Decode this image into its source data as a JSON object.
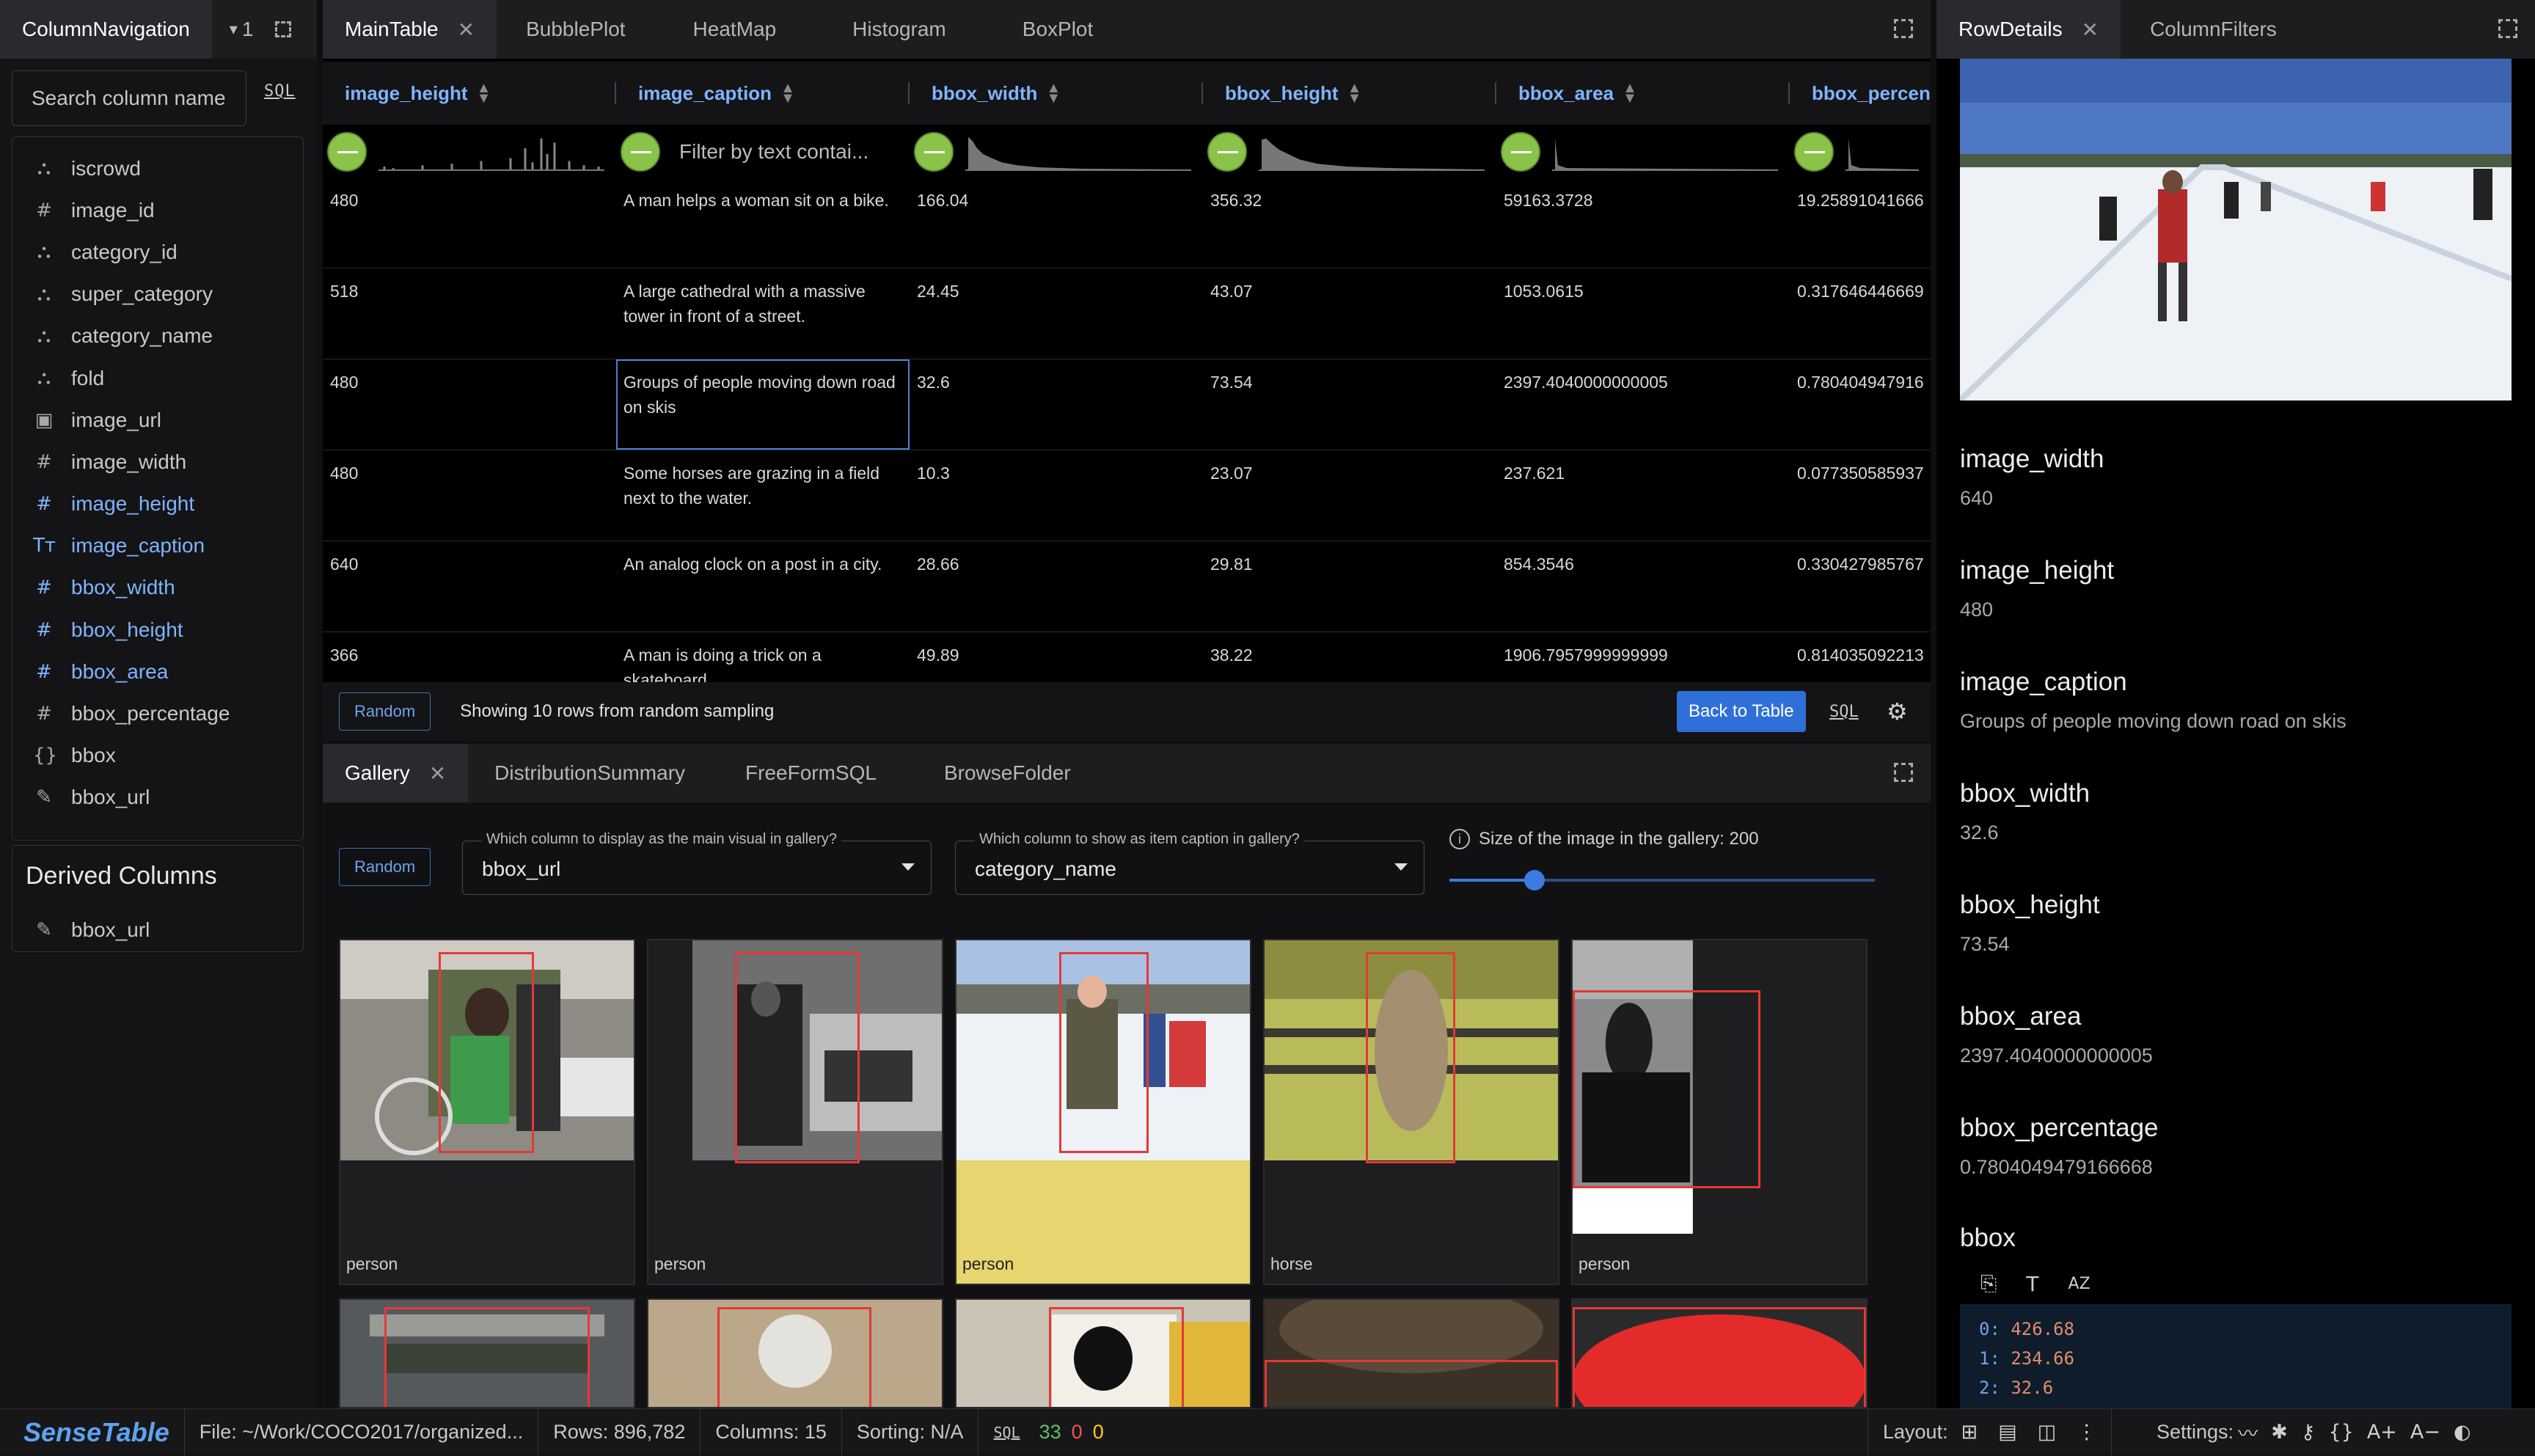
{
  "left_panel": {
    "tab_title": "ColumnNavigation",
    "tab_count": "1",
    "search_placeholder": "Search column name",
    "sql_label": "SQL",
    "columns": [
      {
        "icon": "category-icon",
        "glyph": "⛬",
        "label": "iscrowd",
        "highlighted": false
      },
      {
        "icon": "hash-icon",
        "glyph": "#",
        "label": "image_id",
        "highlighted": false
      },
      {
        "icon": "category-icon",
        "glyph": "⛬",
        "label": "category_id",
        "highlighted": false
      },
      {
        "icon": "category-icon",
        "glyph": "⛬",
        "label": "super_category",
        "highlighted": false
      },
      {
        "icon": "category-icon",
        "glyph": "⛬",
        "label": "category_name",
        "highlighted": false
      },
      {
        "icon": "category-icon",
        "glyph": "⛬",
        "label": "fold",
        "highlighted": false
      },
      {
        "icon": "image-icon",
        "glyph": "▣",
        "label": "image_url",
        "highlighted": false
      },
      {
        "icon": "hash-icon",
        "glyph": "#",
        "label": "image_width",
        "highlighted": false
      },
      {
        "icon": "hash-icon",
        "glyph": "#",
        "label": "image_height",
        "highlighted": true
      },
      {
        "icon": "text-icon",
        "glyph": "Tт",
        "label": "image_caption",
        "highlighted": true
      },
      {
        "icon": "hash-icon",
        "glyph": "#",
        "label": "bbox_width",
        "highlighted": true
      },
      {
        "icon": "hash-icon",
        "glyph": "#",
        "label": "bbox_height",
        "highlighted": true
      },
      {
        "icon": "hash-icon",
        "glyph": "#",
        "label": "bbox_area",
        "highlighted": true
      },
      {
        "icon": "hash-icon",
        "glyph": "#",
        "label": "bbox_percentage",
        "highlighted": false
      },
      {
        "icon": "braces-icon",
        "glyph": "{}",
        "label": "bbox",
        "highlighted": false
      },
      {
        "icon": "brush-icon",
        "glyph": "✎",
        "label": "bbox_url",
        "highlighted": false
      }
    ],
    "derived_title": "Derived Columns",
    "derived_columns": [
      {
        "icon": "brush-icon",
        "glyph": "✎",
        "label": "bbox_url"
      }
    ]
  },
  "main_panel": {
    "tabs": [
      "MainTable",
      "BubblePlot",
      "HeatMap",
      "Histogram",
      "BoxPlot"
    ],
    "columns": [
      "image_height",
      "image_caption",
      "bbox_width",
      "bbox_height",
      "bbox_area",
      "bbox_percen"
    ],
    "caption_filter_placeholder": "Filter by text contai...",
    "rows": [
      {
        "image_height": "480",
        "image_caption": "A man helps a woman sit on a bike.",
        "bbox_width": "166.04",
        "bbox_height": "356.32",
        "bbox_area": "59163.3728",
        "bbox_percentage": "19.25891041666"
      },
      {
        "image_height": "518",
        "image_caption": "A large cathedral with a massive tower in front of a street.",
        "bbox_width": "24.45",
        "bbox_height": "43.07",
        "bbox_area": "1053.0615",
        "bbox_percentage": "0.317646446669"
      },
      {
        "image_height": "480",
        "image_caption": "Groups of people moving down road on skis",
        "bbox_width": "32.6",
        "bbox_height": "73.54",
        "bbox_area": "2397.4040000000005",
        "bbox_percentage": "0.780404947916"
      },
      {
        "image_height": "480",
        "image_caption": "Some horses are grazing in a field next to the water.",
        "bbox_width": "10.3",
        "bbox_height": "23.07",
        "bbox_area": "237.621",
        "bbox_percentage": "0.077350585937"
      },
      {
        "image_height": "640",
        "image_caption": "An analog clock on a post in a city.",
        "bbox_width": "28.66",
        "bbox_height": "29.81",
        "bbox_area": "854.3546",
        "bbox_percentage": "0.330427985767"
      },
      {
        "image_height": "366",
        "image_caption": "A man is doing a trick on a skateboard.",
        "bbox_width": "49.89",
        "bbox_height": "38.22",
        "bbox_area": "1906.7957999999999",
        "bbox_percentage": "0.814035092213"
      }
    ],
    "random_label": "Random",
    "status_text": "Showing 10 rows from random sampling",
    "back_label": "Back to Table",
    "sql_label": "SQL"
  },
  "gallery_panel": {
    "tabs": [
      "Gallery",
      "DistributionSummary",
      "FreeFormSQL",
      "BrowseFolder"
    ],
    "random_label": "Random",
    "visual_label": "Which column to display as the main visual in gallery?",
    "visual_value": "bbox_url",
    "caption_label": "Which column to show as item caption in gallery?",
    "caption_value": "category_name",
    "size_label": "Size of the image in the gallery: 200",
    "size_value": 200,
    "items": [
      {
        "caption": "person",
        "selected": false
      },
      {
        "caption": "person",
        "selected": false
      },
      {
        "caption": "person",
        "selected": true
      },
      {
        "caption": "horse",
        "selected": false
      },
      {
        "caption": "person",
        "selected": false
      }
    ]
  },
  "right_panel": {
    "tabs": [
      "RowDetails",
      "ColumnFilters"
    ],
    "fields": [
      {
        "key": "image_width",
        "value": "640"
      },
      {
        "key": "image_height",
        "value": "480"
      },
      {
        "key": "image_caption",
        "value": "Groups of people moving down road on skis"
      },
      {
        "key": "bbox_width",
        "value": "32.6"
      },
      {
        "key": "bbox_height",
        "value": "73.54"
      },
      {
        "key": "bbox_area",
        "value": "2397.4040000000005"
      },
      {
        "key": "bbox_percentage",
        "value": "0.7804049479166668"
      }
    ],
    "bbox_key": "bbox",
    "bbox_values": [
      "0:",
      "426.68",
      "1:",
      "234.66",
      "2:",
      "32.6"
    ]
  },
  "statusbar": {
    "brand": "SenseTable",
    "file": "File: ~/Work/COCO2017/organized...",
    "rows": "Rows: 896,782",
    "columns": "Columns: 15",
    "sorting": "Sorting: N/A",
    "sql_label": "SQL",
    "count_green": "33",
    "count_red": "0",
    "count_yellow": "0",
    "layout_label": "Layout:",
    "settings_label": "Settings:"
  },
  "colors": {
    "accent_blue": "#7fb4ff",
    "button_blue": "#2f6fd8",
    "filter_green": "#8bc34a",
    "bbox_red": "#e53935",
    "selected_yellow": "#e7d56f"
  }
}
